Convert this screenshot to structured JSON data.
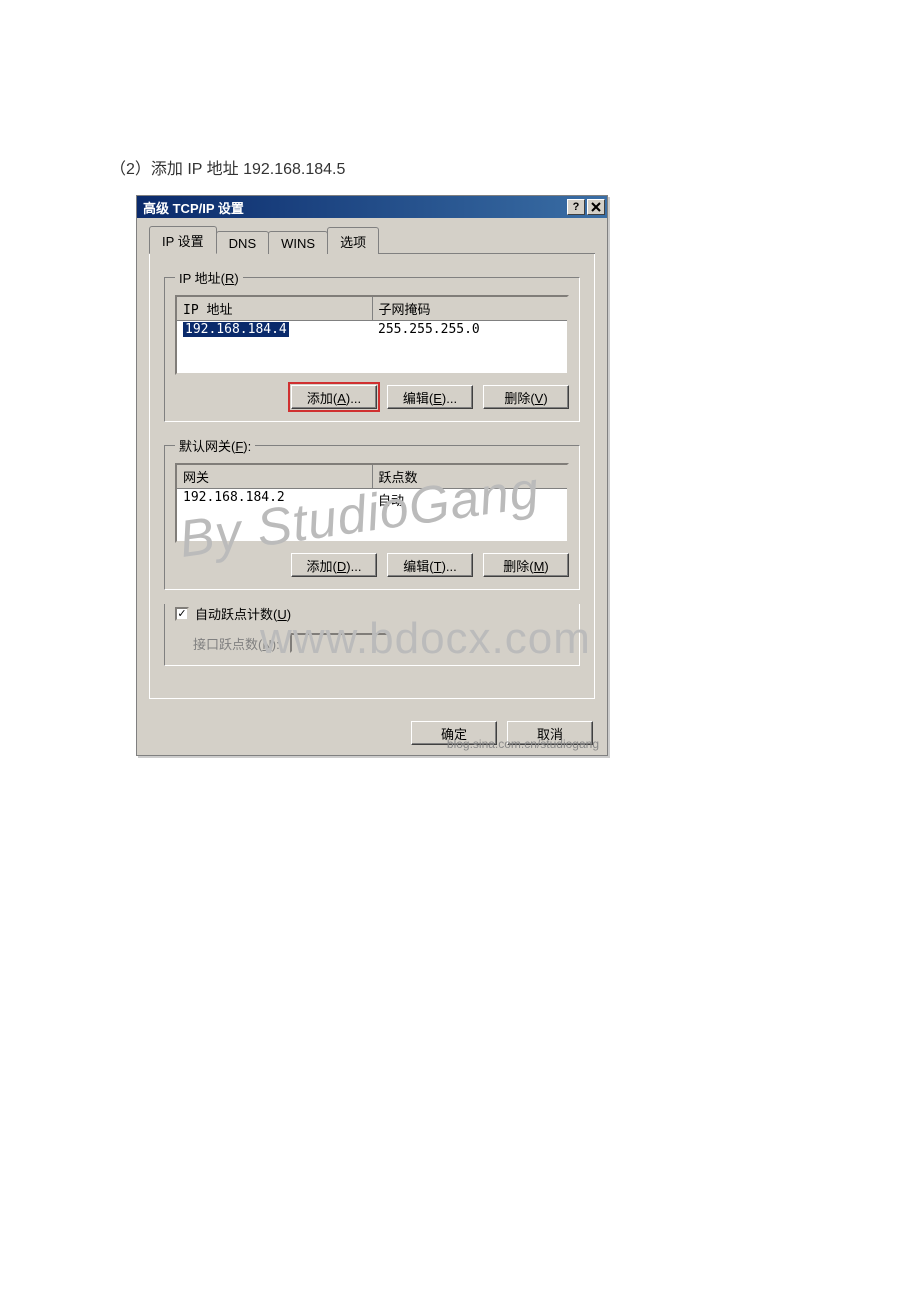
{
  "caption": "（2）添加 IP 地址 192.168.184.5",
  "dialog": {
    "title": "高级 TCP/IP 设置",
    "tabs": [
      "IP 设置",
      "DNS",
      "WINS",
      "选项"
    ],
    "ip_group": {
      "legend": "IP 地址(R)",
      "headers": [
        "IP 地址",
        "子网掩码"
      ],
      "row": {
        "ip": "192.168.184.4",
        "mask": "255.255.255.0"
      },
      "buttons": {
        "add": "添加(A)...",
        "edit": "编辑(E)...",
        "del": "删除(V)"
      }
    },
    "gw_group": {
      "legend": "默认网关(F):",
      "headers": [
        "网关",
        "跃点数"
      ],
      "row": {
        "gw": "192.168.184.2",
        "metric": "自动"
      },
      "buttons": {
        "add": "添加(D)...",
        "edit": "编辑(T)...",
        "del": "删除(M)"
      }
    },
    "auto_metric": {
      "label": "自动跃点计数(U)",
      "checked": true
    },
    "iface_metric_label": "接口跃点数(N):",
    "footer": {
      "ok": "确定",
      "cancel": "取消"
    }
  },
  "watermarks": {
    "main": "www.bdocx.com",
    "side": "By StudioGang",
    "blog": "blog.sina.com.cn/studiogang"
  }
}
